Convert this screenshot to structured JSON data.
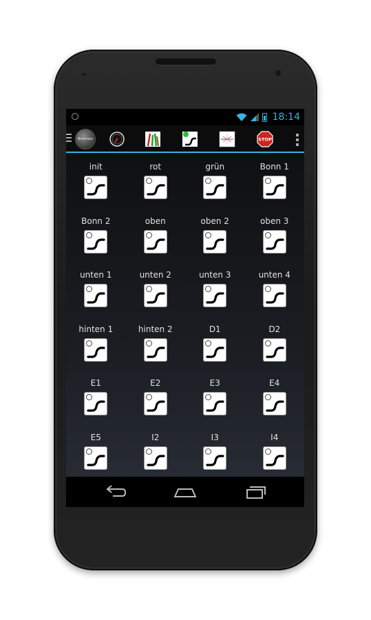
{
  "status_bar": {
    "time": "18:14"
  },
  "action_bar": {
    "logo_text": "Bommes",
    "icons": [
      "drawer-icon",
      "gauge-icon",
      "signal-lights-icon",
      "green-turnout-icon",
      "route-icon",
      "stop-icon",
      "overflow-menu-icon"
    ]
  },
  "switches": [
    {
      "label": "init"
    },
    {
      "label": "rot"
    },
    {
      "label": "grün"
    },
    {
      "label": "Bonn 1"
    },
    {
      "label": "Bonn 2"
    },
    {
      "label": "oben"
    },
    {
      "label": "oben 2"
    },
    {
      "label": "oben 3"
    },
    {
      "label": "unten 1"
    },
    {
      "label": "unten 2"
    },
    {
      "label": "unten 3"
    },
    {
      "label": "unten 4"
    },
    {
      "label": "hinten 1"
    },
    {
      "label": "hinten 2"
    },
    {
      "label": "D1"
    },
    {
      "label": "D2"
    },
    {
      "label": "E1"
    },
    {
      "label": "E2"
    },
    {
      "label": "E3"
    },
    {
      "label": "E4"
    },
    {
      "label": "E5"
    },
    {
      "label": "I2"
    },
    {
      "label": "I3"
    },
    {
      "label": "I4"
    }
  ],
  "stop_label": "STOP",
  "colors": {
    "accent": "#33b5e5",
    "stop_red": "#d32020",
    "active_green": "#22c22a"
  },
  "nav_bar": {
    "icons": [
      "back-icon",
      "home-icon",
      "recent-apps-icon"
    ]
  }
}
